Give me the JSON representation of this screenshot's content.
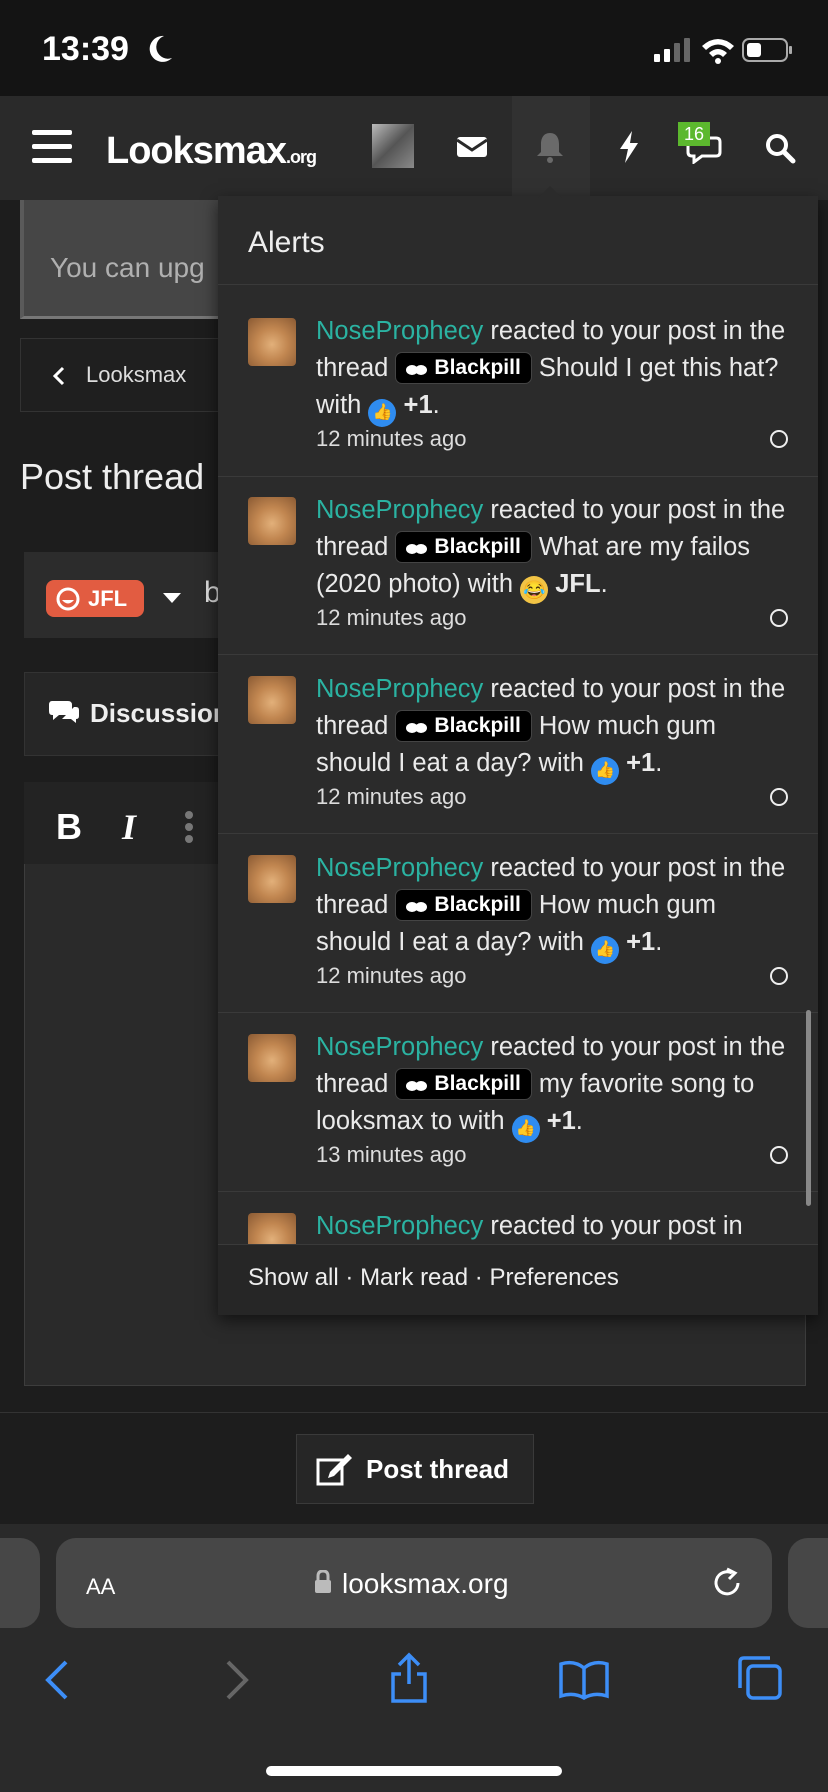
{
  "status_bar": {
    "time": "13:39"
  },
  "site": {
    "logo": "Looksmax",
    "logo_suffix": ".org",
    "notification_badge": "16"
  },
  "background": {
    "upgrade_text": "You can upg",
    "breadcrumb": "Looksmax",
    "page_title": "Post thread",
    "prefix_label": "JFL",
    "title_partial": "b",
    "discussion_label": "Discussion",
    "post_button": "Post thread"
  },
  "alerts": {
    "title": "Alerts",
    "items": [
      {
        "user": "NoseProphecy",
        "action": "reacted to your post in the thread",
        "tag": "Blackpill",
        "thread": "Should I get this hat?",
        "with": "with",
        "reaction": "+1",
        "reaction_icon": "like-icon",
        "time": "12 minutes ago"
      },
      {
        "user": "NoseProphecy",
        "action": "reacted to your post in the thread",
        "tag": "Blackpill",
        "thread": "What are my failos (2020 photo)",
        "with": "with",
        "reaction": "JFL",
        "reaction_icon": "laugh-cry-emoji-icon",
        "time": "12 minutes ago"
      },
      {
        "user": "NoseProphecy",
        "action": "reacted to your post in the thread",
        "tag": "Blackpill",
        "thread": "How much gum should I eat a day?",
        "with": "with",
        "reaction": "+1",
        "reaction_icon": "like-icon",
        "time": "12 minutes ago"
      },
      {
        "user": "NoseProphecy",
        "action": "reacted to your post in the thread",
        "tag": "Blackpill",
        "thread": "How much gum should I eat a day?",
        "with": "with",
        "reaction": "+1",
        "reaction_icon": "like-icon",
        "time": "12 minutes ago"
      },
      {
        "user": "NoseProphecy",
        "action": "reacted to your post in the thread",
        "tag": "Blackpill",
        "thread": "my favorite song to looksmax to",
        "with": "with",
        "reaction": "+1",
        "reaction_icon": "like-icon",
        "time": "13 minutes ago"
      },
      {
        "user": "NoseProphecy",
        "action": "reacted to your post in"
      }
    ],
    "footer": {
      "show_all": "Show all",
      "mark_read": "Mark read",
      "preferences": "Preferences",
      "separator": "·"
    }
  },
  "browser": {
    "aa_label": "AA",
    "url": "looksmax.org"
  },
  "colors": {
    "username": "#2bb3a2",
    "badge": "#5cb82e",
    "prefix": "#e25c41",
    "safari_blue": "#3d8ef7"
  }
}
